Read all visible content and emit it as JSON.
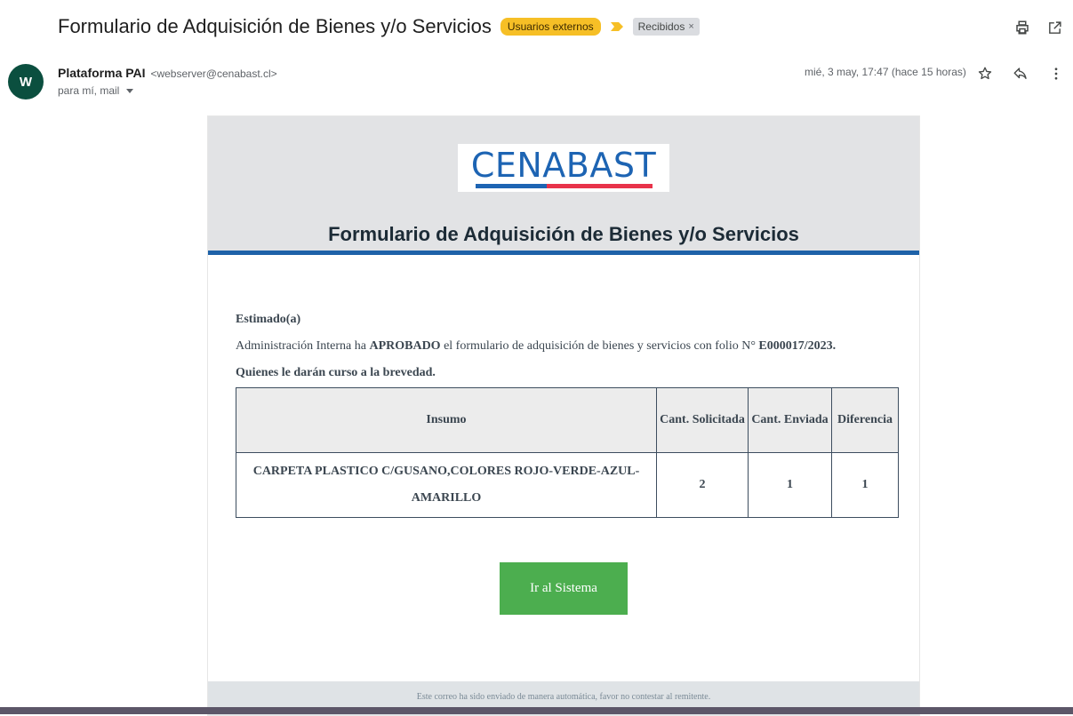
{
  "subject": {
    "title": "Formulario de Adquisición de Bienes y/o Servicios",
    "label_external": "Usuarios externos",
    "label_inbox": "Recibidos",
    "label_inbox_remove": "×"
  },
  "icons": {
    "importance": "importance-marker-icon",
    "print": "print-icon",
    "open_new_window": "open-in-new-window-icon",
    "star": "star-icon",
    "reply": "reply-icon",
    "more": "more-vert-icon",
    "recipients_caret": "chevron-down-icon"
  },
  "sender": {
    "avatar_letter": "W",
    "name": "Plataforma PAI",
    "email": "<webserver@cenabast.cl>",
    "recipients": "para mí, mail",
    "date": "mié, 3 may, 17:47 (hace 15 horas)"
  },
  "email": {
    "logo_text": "CENABAST",
    "title": "Formulario de Adquisición de Bienes y/o Servicios",
    "greeting": "Estimado(a)",
    "line_pre": "Administración Interna ha ",
    "line_status": "APROBADO",
    "line_mid": " el formulario de adquisición de bienes y servicios con folio N° ",
    "line_folio": "E000017/2023.",
    "closing": "Quienes le darán curso a la brevedad.",
    "table": {
      "headers": [
        "Insumo",
        "Cant. Solicitada",
        "Cant. Enviada",
        "Diferencia"
      ],
      "rows": [
        [
          "CARPETA PLASTICO C/GUSANO,COLORES ROJO-VERDE-AZUL-AMARILLO",
          "2",
          "1",
          "1"
        ]
      ]
    },
    "button_label": "Ir al Sistema",
    "footer": "Este correo ha sido enviado de manera automática, favor no contestar al remitente."
  },
  "colors": {
    "accent_blue": "#1e62a8",
    "label_yellow": "#f6bf26",
    "button_green": "#4cae4f",
    "avatar_green": "#0b4f3f"
  }
}
